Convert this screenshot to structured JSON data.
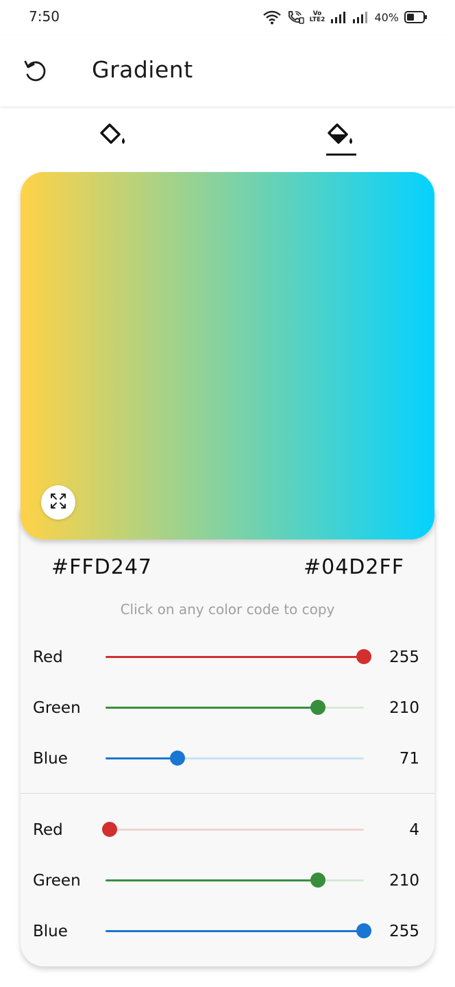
{
  "status_bar": {
    "time": "7:50",
    "battery_percent": "40%",
    "icons": [
      "wifi-icon",
      "wifi-calling-icon",
      "volte-icon",
      "signal-icon",
      "signal-icon",
      "battery-icon"
    ],
    "volte_label": "Vo LTE2"
  },
  "app_bar": {
    "title": "Gradient",
    "back_icon": "undo-icon"
  },
  "tabs": [
    {
      "icon": "paint-bucket-outline-icon",
      "selected": false
    },
    {
      "icon": "paint-bucket-filled-icon",
      "selected": true
    }
  ],
  "gradient": {
    "start_color": "#FFD247",
    "end_color": "#04D2FF",
    "expand_icon": "fullscreen-icon"
  },
  "color_codes": {
    "start": "#FFD247",
    "end": "#04D2FF",
    "hint": "Click on any color code to copy"
  },
  "start_sliders": [
    {
      "label": "Red",
      "value": "255",
      "level": 1.0,
      "color": "#d32f2f",
      "track": "#f4c7c7"
    },
    {
      "label": "Green",
      "value": "210",
      "level": 0.8235,
      "color": "#388e3c",
      "track": "#d4ead5"
    },
    {
      "label": "Blue",
      "value": "71",
      "level": 0.2784,
      "color": "#1976d2",
      "track": "#c8e2f5"
    }
  ],
  "end_sliders": [
    {
      "label": "Red",
      "value": "4",
      "level": 0.0157,
      "color": "#d32f2f",
      "track": "#f4d4d4"
    },
    {
      "label": "Green",
      "value": "210",
      "level": 0.8235,
      "color": "#388e3c",
      "track": "#d4ead5"
    },
    {
      "label": "Blue",
      "value": "255",
      "level": 1.0,
      "color": "#1976d2",
      "track": "#c8e2f5"
    }
  ]
}
